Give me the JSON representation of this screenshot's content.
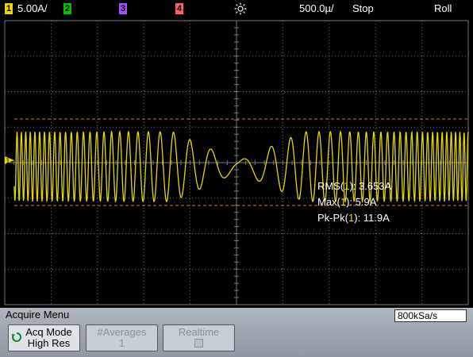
{
  "topbar": {
    "ch1_num": "1",
    "ch1_scale": "5.00A/",
    "ch2_num": "2",
    "ch3_num": "3",
    "ch4_num": "4",
    "timebase": "500.0µ/",
    "run_state": "Stop",
    "trigger_mode": "Roll",
    "trigger_icon": "sun-icon"
  },
  "colors": {
    "ch1": "#e6d700",
    "ch2": "#00c000",
    "ch3": "#a050ff",
    "ch4": "#ff6060",
    "grid": "#888888",
    "cursor_line": "#e07030",
    "menu_bg": "#9aa3ae"
  },
  "trace": {
    "channel_marker": "1",
    "waveform": "chirp-decreasing-then-increasing-frequency"
  },
  "measurements": {
    "rms_prefix": "RMS(",
    "rms_ch": "1",
    "rms_suffix": "): 3.653A",
    "max_prefix": "Max(",
    "max_ch": "1",
    "max_suffix": "): 5.9A",
    "pkpk_prefix": "Pk-Pk(",
    "pkpk_ch": "1",
    "pkpk_suffix": "): 11.9A"
  },
  "menu": {
    "title": "Acquire Menu",
    "sample_rate": "800kSa/s",
    "acq_mode_label": "Acq Mode",
    "acq_mode_value": "High Res",
    "averages_label": "#Averages",
    "averages_value": "1",
    "realtime_label": "Realtime"
  }
}
